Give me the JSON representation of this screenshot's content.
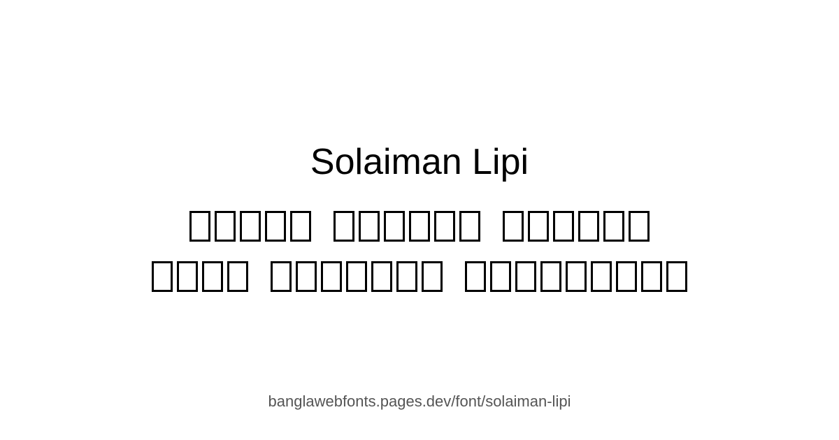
{
  "font_name": "Solaiman Lipi",
  "footer_url": "banglawebfonts.pages.dev/font/solaiman-lipi",
  "sample_text": {
    "line1_words": [
      5,
      6,
      6
    ],
    "line2_words": [
      4,
      7,
      9
    ]
  },
  "colors": {
    "background": "#ffffff",
    "text": "#000000",
    "footer_text": "#555555"
  }
}
